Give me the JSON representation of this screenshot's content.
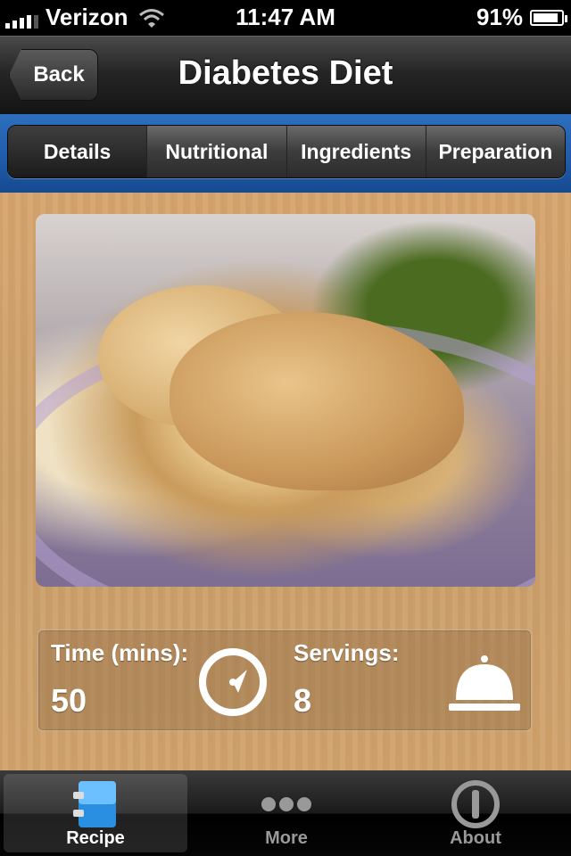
{
  "status_bar": {
    "carrier": "Verizon",
    "time": "11:47 AM",
    "battery": "91%",
    "battery_level": 0.91
  },
  "nav": {
    "back_label": "Back",
    "title": "Diabetes Diet"
  },
  "segments": {
    "items": [
      "Details",
      "Nutritional",
      "Ingredients",
      "Preparation"
    ],
    "selected": "Details"
  },
  "photo": {
    "icon": "recipe-photo"
  },
  "info": {
    "time_label": "Time (mins):",
    "time_value": "50",
    "servings_label": "Servings:",
    "servings_value": "8",
    "time_icon": "clock-icon",
    "servings_icon": "serving-dish-icon"
  },
  "tabs": {
    "items": [
      {
        "label": "Recipe",
        "icon": "recipe-book-icon"
      },
      {
        "label": "More",
        "icon": "more-dots-icon"
      },
      {
        "label": "About",
        "icon": "about-icon"
      }
    ],
    "selected": "Recipe"
  },
  "colors": {
    "accent_blue": "#1f5aa8",
    "recipe_icon_blue": "#2a8fe0"
  }
}
